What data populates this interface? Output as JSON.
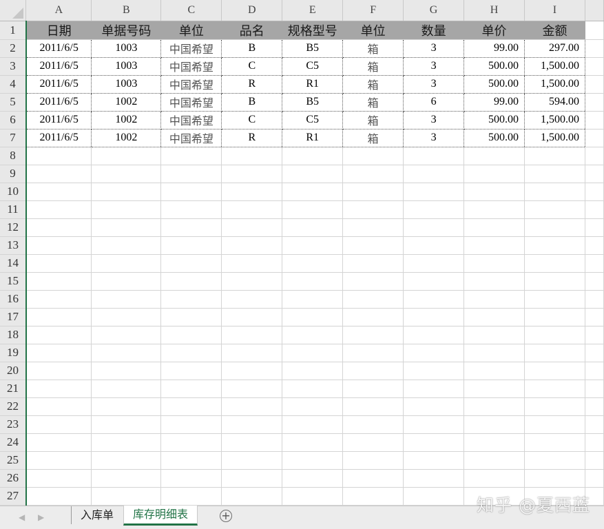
{
  "columns": [
    "A",
    "B",
    "C",
    "D",
    "E",
    "F",
    "G",
    "H",
    "I"
  ],
  "header_row": [
    "日期",
    "单据号码",
    "单位",
    "品名",
    "规格型号",
    "单位",
    "数量",
    "单价",
    "金额"
  ],
  "rows": [
    [
      "2011/6/5",
      "1003",
      "中国希望",
      "B",
      "B5",
      "箱",
      "3",
      "99.00",
      "297.00"
    ],
    [
      "2011/6/5",
      "1003",
      "中国希望",
      "C",
      "C5",
      "箱",
      "3",
      "500.00",
      "1,500.00"
    ],
    [
      "2011/6/5",
      "1003",
      "中国希望",
      "R",
      "R1",
      "箱",
      "3",
      "500.00",
      "1,500.00"
    ],
    [
      "2011/6/5",
      "1002",
      "中国希望",
      "B",
      "B5",
      "箱",
      "6",
      "99.00",
      "594.00"
    ],
    [
      "2011/6/5",
      "1002",
      "中国希望",
      "C",
      "C5",
      "箱",
      "3",
      "500.00",
      "1,500.00"
    ],
    [
      "2011/6/5",
      "1002",
      "中国希望",
      "R",
      "R1",
      "箱",
      "3",
      "500.00",
      "1,500.00"
    ]
  ],
  "row_numbers": [
    "1",
    "2",
    "3",
    "4",
    "5",
    "6",
    "7",
    "8",
    "9",
    "10",
    "11",
    "12",
    "13",
    "14",
    "15",
    "16",
    "17",
    "18",
    "19",
    "20",
    "21",
    "22",
    "23",
    "24",
    "25",
    "26",
    "27"
  ],
  "sheet_tabs": [
    {
      "label": "入库单",
      "active": false
    },
    {
      "label": "库存明细表",
      "active": true
    }
  ],
  "nav": {
    "prev": "◀",
    "next": "▶"
  },
  "add_sheet_label": "+",
  "watermark": "知乎 @夏西蓝",
  "colors": {
    "accent": "#217346",
    "header_fill": "#a6a6a6",
    "chrome": "#e8e8e8"
  },
  "icons": {
    "corner": "select-all-triangle-icon",
    "add": "plus-circle-icon",
    "prev": "triangle-left-icon",
    "next": "triangle-right-icon"
  }
}
